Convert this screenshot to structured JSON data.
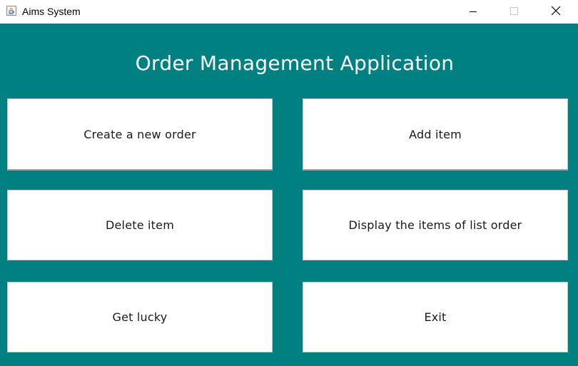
{
  "window": {
    "title": "Aims System",
    "app_icon": "java-coffee-icon",
    "controls": {
      "minimize_icon": "minimize-icon",
      "maximize_icon": "maximize-icon",
      "close_icon": "close-icon"
    }
  },
  "main": {
    "heading": "Order Management Application",
    "background_color": "#008080",
    "buttons": [
      {
        "label": "Create a new order"
      },
      {
        "label": "Add item"
      },
      {
        "label": "Delete item"
      },
      {
        "label": "Display the items of list order"
      },
      {
        "label": "Get lucky"
      },
      {
        "label": "Exit"
      }
    ]
  }
}
